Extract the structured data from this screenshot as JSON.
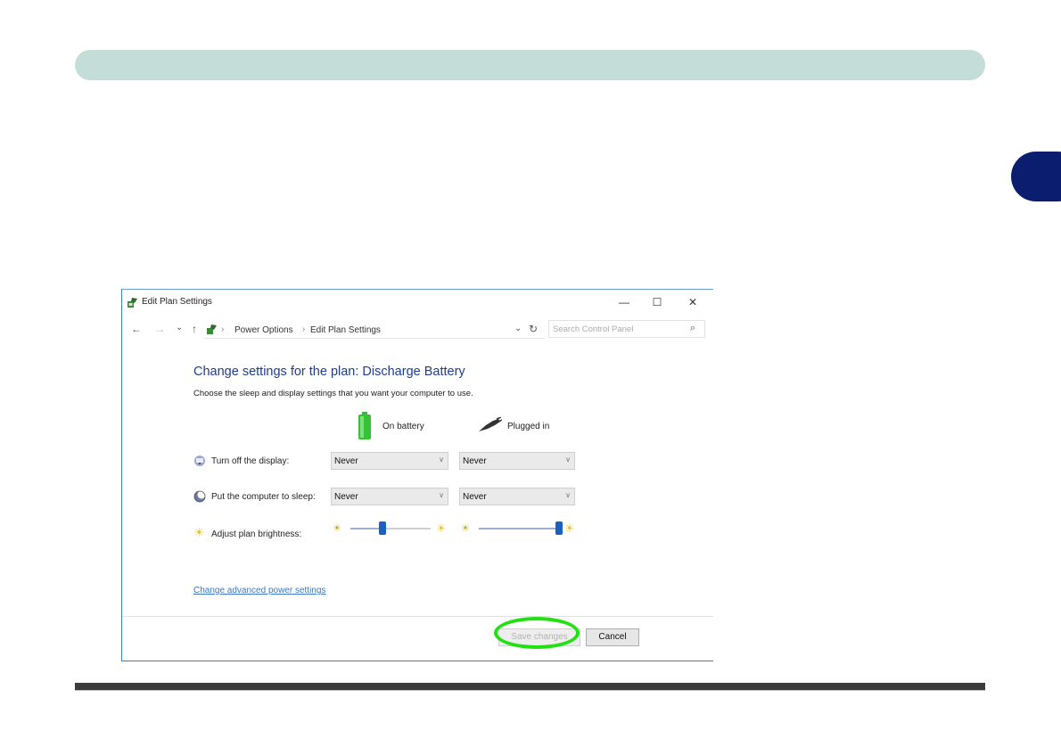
{
  "page": {
    "header_bar_color": "#c5ddd8",
    "side_tab_color": "#0b1d6f"
  },
  "window": {
    "title": "Edit Plan Settings",
    "controls": {
      "minimize": "—",
      "maximize": "☐",
      "close": "✕"
    },
    "nav": {
      "back": "←",
      "forward": "→",
      "recent": "⌄",
      "up": "↑"
    },
    "breadcrumb": {
      "separator": "›",
      "items": [
        "Power Options",
        "Edit Plan Settings"
      ],
      "dropdown": "⌄",
      "refresh": "↻"
    },
    "search": {
      "placeholder": "Search Control Panel",
      "icon": "search-icon"
    }
  },
  "content": {
    "title": "Change settings for the plan: Discharge Battery",
    "subtitle": "Choose the sleep and display settings that you want your computer to use.",
    "columns": [
      {
        "label": "On battery",
        "icon": "battery-icon"
      },
      {
        "label": "Plugged in",
        "icon": "power-plug-icon"
      }
    ],
    "rows": {
      "display": {
        "label": "Turn off the display:",
        "on_battery": "Never",
        "plugged_in": "Never",
        "icon": "monitor-icon"
      },
      "sleep": {
        "label": "Put the computer to sleep:",
        "on_battery": "Never",
        "plugged_in": "Never",
        "icon": "moon-icon"
      },
      "brightness": {
        "label": "Adjust plan brightness:",
        "on_battery_level": 0.4,
        "plugged_in_level": 1.0,
        "icon": "brightness-icon"
      }
    },
    "advanced_link": "Change advanced power settings"
  },
  "buttons": {
    "save": "Save changes",
    "cancel": "Cancel"
  },
  "highlight_color": "#22e012"
}
